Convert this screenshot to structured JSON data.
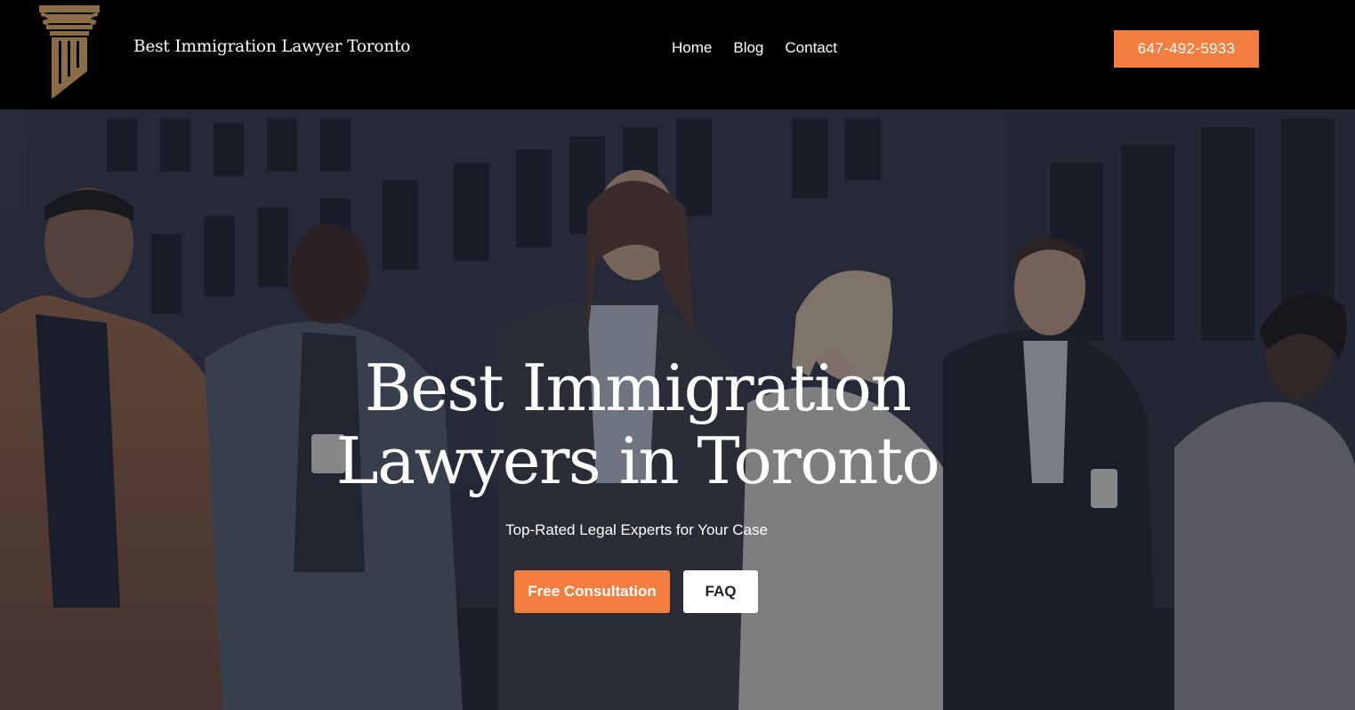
{
  "header": {
    "site_title": "Best Immigration Lawyer Toronto",
    "logo_icon": "column-pillar-icon",
    "nav": [
      {
        "label": "Home"
      },
      {
        "label": "Blog"
      },
      {
        "label": "Contact"
      }
    ],
    "phone_label": "647-492-5933"
  },
  "hero": {
    "headline_line1": "Best Immigration",
    "headline_line2": "Lawyers in Toronto",
    "subtitle": "Top-Rated Legal Experts for Your Case",
    "primary_cta": "Free Consultation",
    "secondary_cta": "FAQ",
    "background_image": "group-of-business-people-walking-photo"
  },
  "colors": {
    "accent": "#f47e3f",
    "header_bg": "#000000",
    "logo_gold": "#8a6d45",
    "text": "#ffffff"
  }
}
